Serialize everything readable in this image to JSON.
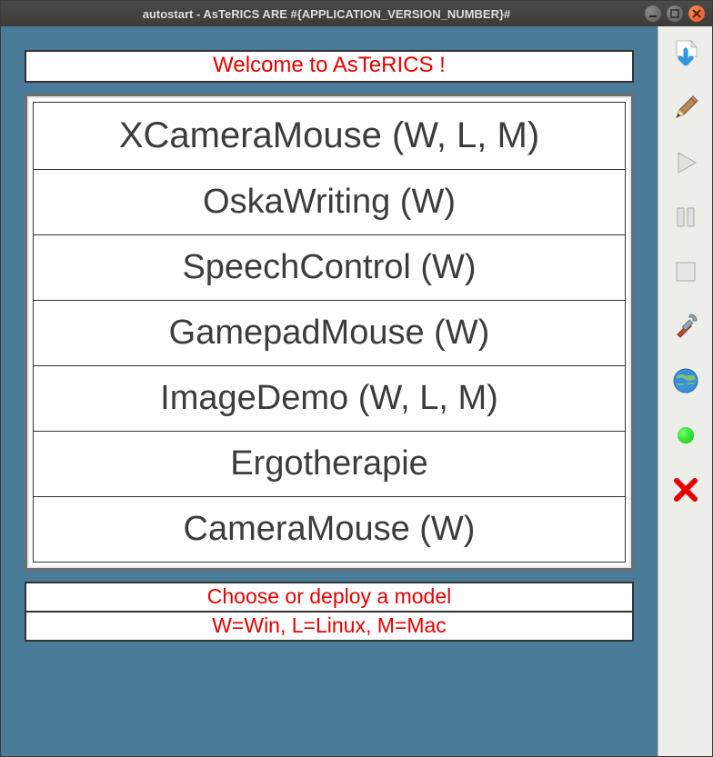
{
  "window": {
    "title": "autostart - AsTeRICS ARE #{APPLICATION_VERSION_NUMBER}#"
  },
  "header": {
    "welcome": "Welcome to AsTeRICS !"
  },
  "models": [
    {
      "label": "XCameraMouse (W, L, M)"
    },
    {
      "label": "OskaWriting (W)"
    },
    {
      "label": "SpeechControl (W)"
    },
    {
      "label": "GamepadMouse (W)"
    },
    {
      "label": "ImageDemo (W, L, M)"
    },
    {
      "label": "Ergotherapie"
    },
    {
      "label": "CameraMouse (W)"
    }
  ],
  "footer": {
    "line1": "Choose or deploy a model",
    "line2": "W=Win, L=Linux, M=Mac"
  },
  "sidebar": {
    "icons": {
      "download": "download-icon",
      "edit": "pencil-icon",
      "play": "play-icon",
      "pause": "pause-icon",
      "stop": "stop-icon",
      "tools": "tools-icon",
      "globe": "globe-icon",
      "status": "status-active-icon",
      "close": "close-icon"
    }
  }
}
